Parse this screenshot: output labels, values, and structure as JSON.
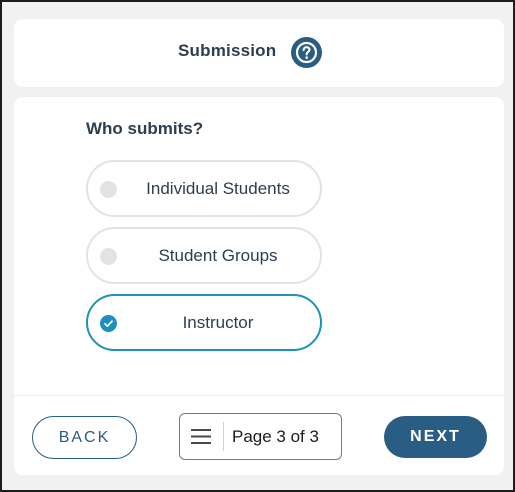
{
  "header": {
    "title": "Submission",
    "help_icon": "question-circle-icon"
  },
  "question": {
    "label": "Who submits?",
    "options": [
      {
        "label": "Individual Students",
        "selected": false
      },
      {
        "label": "Student Groups",
        "selected": false
      },
      {
        "label": "Instructor",
        "selected": true
      }
    ]
  },
  "footer": {
    "back_label": "BACK",
    "page_text": "Page 3 of 3",
    "next_label": "NEXT",
    "menu_icon": "hamburger-menu-icon"
  },
  "colors": {
    "primary": "#2a5d84",
    "selected_accent": "#1d93b8",
    "text": "#2c3e50",
    "background": "#f1f1f1"
  }
}
